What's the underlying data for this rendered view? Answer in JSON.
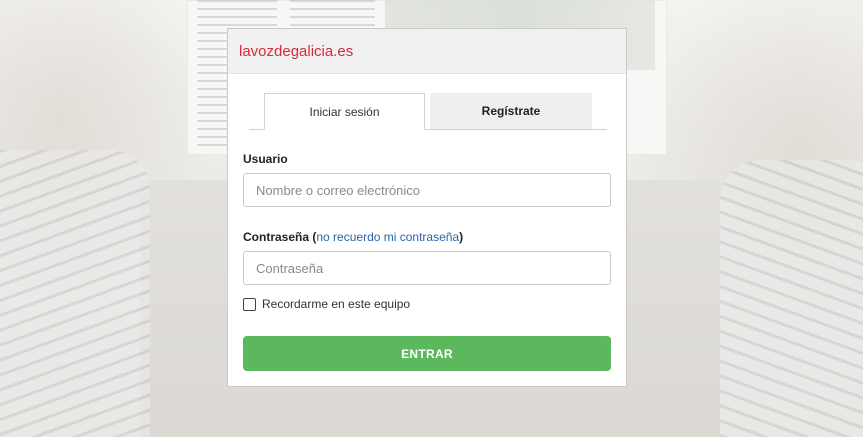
{
  "modal": {
    "site_title": "lavozdegalicia.es"
  },
  "tabs": {
    "login_label": "Iniciar sesión",
    "register_label": "Regístrate"
  },
  "form": {
    "user_label": "Usuario",
    "user_placeholder": "Nombre o correo electrónico",
    "user_value": "",
    "password_label": "Contraseña",
    "password_link_open": "(",
    "password_link": "no recuerdo mi contraseña",
    "password_link_close": ")",
    "password_placeholder": "Contraseña",
    "password_value": "",
    "remember_label": "Recordarme en este equipo",
    "remember_checked": false,
    "submit_label": "ENTRAR"
  },
  "colors": {
    "brand": "#d9283a",
    "link": "#2b64a8",
    "submit": "#5cb85c"
  }
}
